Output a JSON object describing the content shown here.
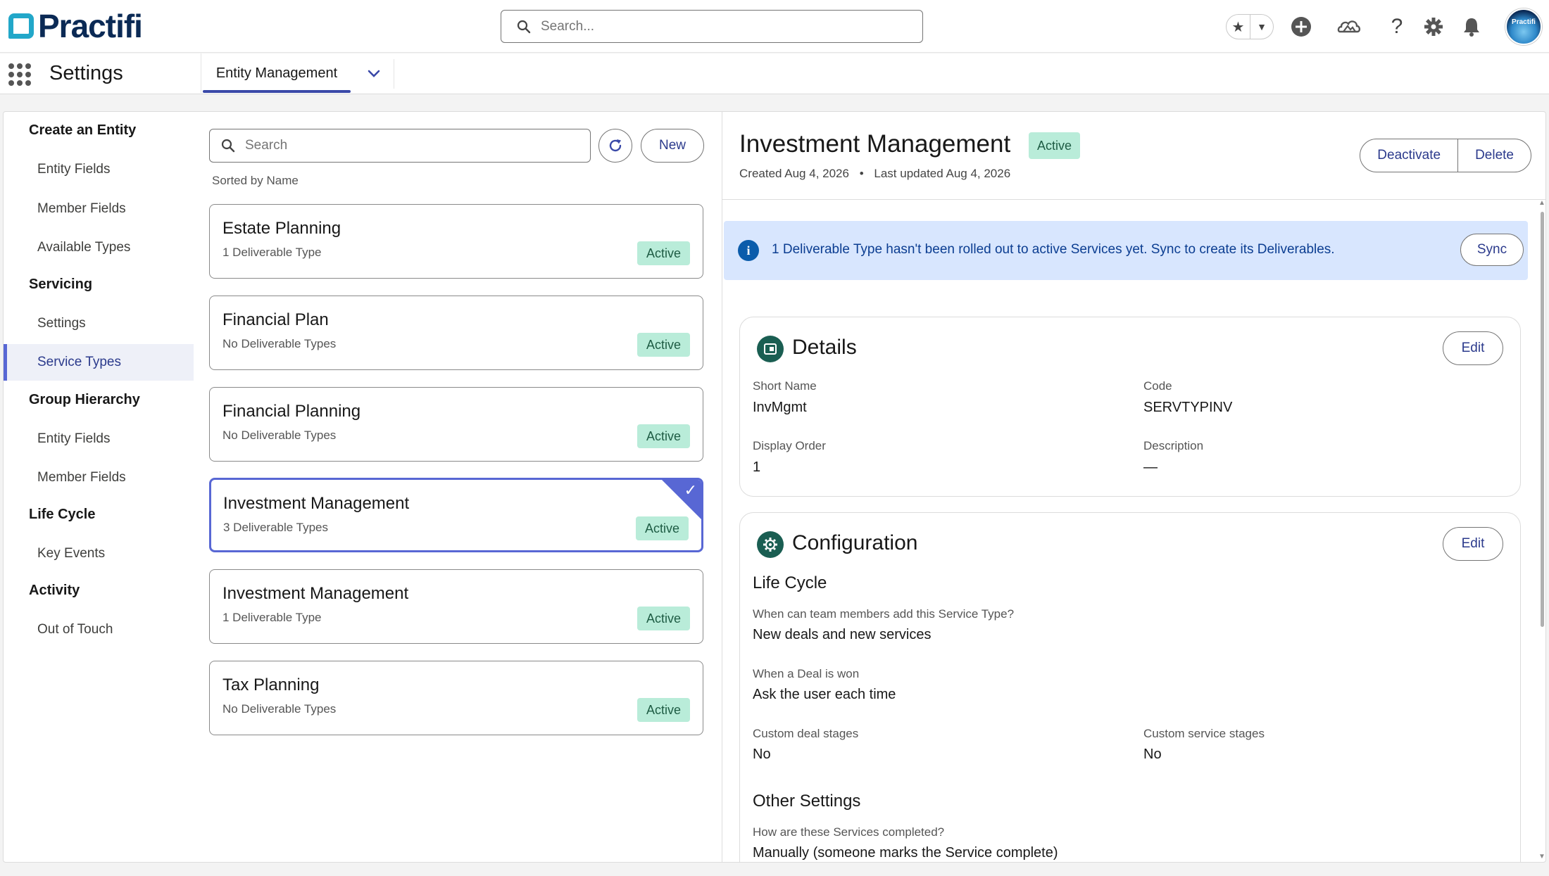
{
  "header": {
    "brand": "Practifi",
    "search_placeholder": "Search...",
    "avatar_text": "Practifi"
  },
  "icons": {
    "favorites": "star-icon",
    "favorites_menu": "chevron-down-icon",
    "global_actions": "plus-circle-icon",
    "trailhead": "cloud-mountain-icon",
    "help": "question-icon",
    "setup": "gear-icon",
    "notifications": "bell-icon"
  },
  "appnav": {
    "app_name": "Settings",
    "active_tab": "Entity Management"
  },
  "leftnav": {
    "groups": [
      {
        "heading": "Create an Entity",
        "items": [
          "Entity Fields",
          "Member Fields",
          "Available Types"
        ]
      },
      {
        "heading": "Servicing",
        "items": [
          "Settings",
          "Service Types"
        ]
      },
      {
        "heading": "Group Hierarchy",
        "items": [
          "Entity Fields",
          "Member Fields"
        ]
      },
      {
        "heading": "Life Cycle",
        "items": [
          "Key Events"
        ]
      },
      {
        "heading": "Activity",
        "items": [
          "Out of Touch"
        ]
      }
    ],
    "selected": "Service Types"
  },
  "list": {
    "search_placeholder": "Search",
    "new_label": "New",
    "sorted_label": "Sorted by Name",
    "items": [
      {
        "title": "Estate Planning",
        "sub": "1 Deliverable Type",
        "status": "Active"
      },
      {
        "title": "Financial Plan",
        "sub": "No Deliverable Types",
        "status": "Active"
      },
      {
        "title": "Financial Planning",
        "sub": "No Deliverable Types",
        "status": "Active"
      },
      {
        "title": "Investment Management",
        "sub": "3 Deliverable Types",
        "status": "Active",
        "selected": true
      },
      {
        "title": "Investment Management",
        "sub": "1 Deliverable Type",
        "status": "Active"
      },
      {
        "title": "Tax Planning",
        "sub": "No Deliverable Types",
        "status": "Active"
      }
    ]
  },
  "detail": {
    "title": "Investment Management",
    "status": "Active",
    "created": "Created Aug 4, 2026",
    "separator": "•",
    "updated": "Last updated Aug 4, 2026",
    "deactivate_label": "Deactivate",
    "delete_label": "Delete",
    "banner": {
      "icon": "i",
      "message": "1 Deliverable Type hasn't been rolled out to active Services yet. Sync to create its Deliverables.",
      "sync_label": "Sync"
    },
    "details": {
      "title": "Details",
      "edit_label": "Edit",
      "short_name_label": "Short Name",
      "short_name": "InvMgmt",
      "code_label": "Code",
      "code": "SERVTYPINV",
      "display_order_label": "Display Order",
      "display_order": "1",
      "description_label": "Description",
      "description": "—"
    },
    "configuration": {
      "title": "Configuration",
      "edit_label": "Edit",
      "lifecycle_heading": "Life Cycle",
      "q1_label": "When can team members add this Service Type?",
      "q1_value": "New deals and new services",
      "q2_label": "When a Deal is won",
      "q2_value": "Ask the user each time",
      "q3_label": "Custom deal stages",
      "q3_value": "No",
      "q4_label": "Custom service stages",
      "q4_value": "No",
      "other_heading": "Other Settings",
      "q5_label": "How are these Services completed?",
      "q5_value": "Manually (someone marks the Service complete)"
    }
  },
  "colors": {
    "brand_navy": "#0b2a55",
    "brand_teal": "#22a7c9",
    "accent": "#5867d4",
    "badge_bg": "#b9ecd9",
    "banner_bg": "#d8e6fe"
  }
}
